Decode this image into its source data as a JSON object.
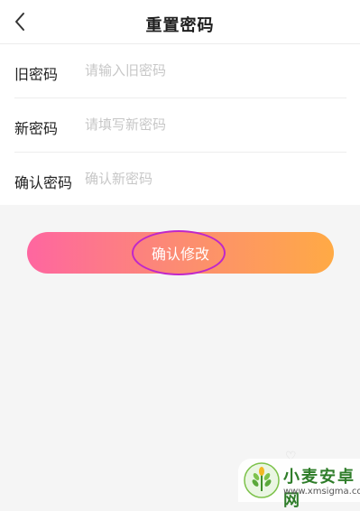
{
  "header": {
    "title": "重置密码",
    "back_icon": "chevron-left-icon"
  },
  "form": {
    "old_password": {
      "label": "旧密码",
      "placeholder": "请输入旧密码",
      "value": ""
    },
    "new_password": {
      "label": "新密码",
      "placeholder": "请填写新密码",
      "value": ""
    },
    "confirm_password": {
      "label": "确认密码",
      "placeholder": "确认新密码",
      "value": ""
    }
  },
  "submit": {
    "label": "确认修改",
    "gradient_start": "#fe66a0",
    "gradient_end": "#ffaa45"
  },
  "annotation": {
    "color": "#c027c9"
  },
  "watermark": {
    "title": "小麦安卓网",
    "url": "www.xmsigma.com",
    "icon": "wheat-logo-icon"
  }
}
